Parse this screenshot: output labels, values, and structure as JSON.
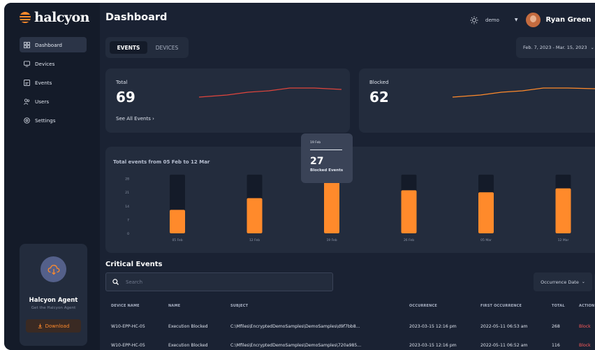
{
  "app": {
    "name": "halcyon"
  },
  "colors": {
    "accent": "#ff8a2b",
    "bg": "#1a2233",
    "card": "#232c3d",
    "sidebar": "#141b29",
    "line": "#e0453d",
    "danger": "#ff5b5b"
  },
  "sidebar": {
    "items": [
      {
        "label": "Dashboard",
        "icon": "dashboard-icon",
        "active": true
      },
      {
        "label": "Devices",
        "icon": "monitor-icon",
        "active": false
      },
      {
        "label": "Events",
        "icon": "events-icon",
        "active": false
      },
      {
        "label": "Users",
        "icon": "users-icon",
        "active": false
      },
      {
        "label": "Settings",
        "icon": "settings-icon",
        "active": false
      }
    ],
    "agent": {
      "title": "Halcyon Agent",
      "subtitle": "Get the Halcyon Agent",
      "download_label": "Download",
      "icon": "cloud-download-icon"
    }
  },
  "header": {
    "title": "Dashboard",
    "theme_icon": "sun-icon",
    "org": "demo",
    "user_name": "Ryan Green"
  },
  "tabs": [
    {
      "label": "EVENTS",
      "active": true
    },
    {
      "label": "DEVICES",
      "active": false
    }
  ],
  "date_range": "Feb. 7, 2023 - Mar. 15, 2023",
  "cards": {
    "total": {
      "label": "Total",
      "value": "69",
      "link": "See All Events"
    },
    "blocked": {
      "label": "Blocked",
      "value": "62"
    }
  },
  "chart_data": {
    "type": "bar",
    "title": "Total events from 05 Feb to 12 Mar",
    "categories": [
      "05 Feb",
      "12 Feb",
      "19 Feb",
      "26 Feb",
      "05 Mar",
      "12 Mar"
    ],
    "values": [
      12,
      18,
      27,
      22,
      21,
      23
    ],
    "ylim": [
      0,
      30
    ],
    "yticks": [
      "0",
      "7",
      "14",
      "21",
      "28"
    ],
    "tooltip": {
      "date": "19 Feb",
      "value": "27",
      "label": "Blocked Events"
    }
  },
  "critical_events": {
    "title": "Critical Events",
    "search_placeholder": "Search",
    "sort_label": "Occurrence Date",
    "columns": [
      "DEVICE NAME",
      "NAME",
      "SUBJECT",
      "OCCURRENCE",
      "FIRST OCCURRENCE",
      "TOTAL",
      "ACTION"
    ],
    "rows": [
      [
        "W10-EPP-HC-05",
        "Execution Blocked",
        "C:\\Mfiles\\EncryptedDemoSamples\\DemoSamples\\d9f7bb8...",
        "2023-03-15 12:16 pm",
        "2022-05-11 06:53 am",
        "268",
        "Block"
      ],
      [
        "W10-EPP-HC-05",
        "Execution Blocked",
        "C:\\Mfiles\\EncryptedDemoSamples\\DemoSamples\\720a985...",
        "2023-03-15 12:16 pm",
        "2022-05-11 06:52 am",
        "116",
        "Block"
      ]
    ]
  }
}
